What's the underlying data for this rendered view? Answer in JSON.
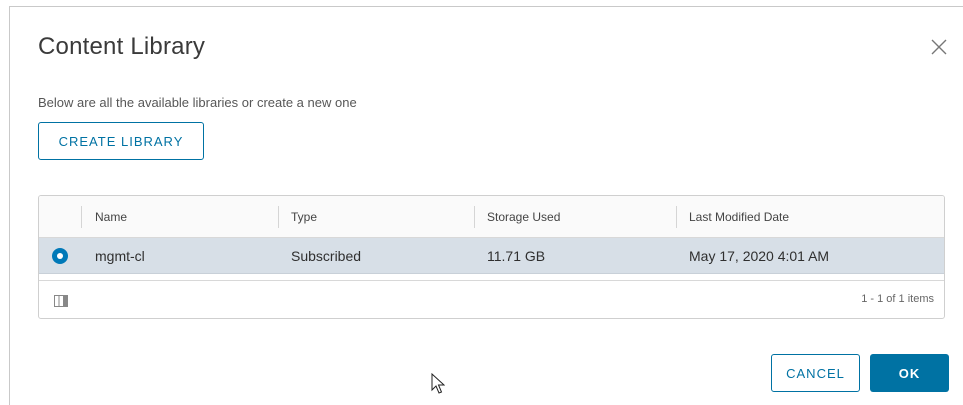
{
  "dialog": {
    "title": "Content Library",
    "subtitle": "Below are all the available libraries or create a new one",
    "create_label": "CREATE LIBRARY"
  },
  "table": {
    "columns": [
      "Name",
      "Type",
      "Storage Used",
      "Last Modified Date"
    ],
    "rows": [
      {
        "name": "mgmt-cl",
        "type": "Subscribed",
        "storage": "11.71 GB",
        "modified": "May 17, 2020 4:01 AM",
        "selected": true
      }
    ],
    "footer": "1 - 1 of 1 items"
  },
  "actions": {
    "cancel_label": "CANCEL",
    "ok_label": "OK"
  },
  "colors": {
    "accent": "#0072a3",
    "selected_row": "#d7dfe7"
  },
  "icons": [
    "close-icon",
    "radio-selected-icon",
    "column-toggle-icon",
    "mouse-pointer-icon"
  ]
}
